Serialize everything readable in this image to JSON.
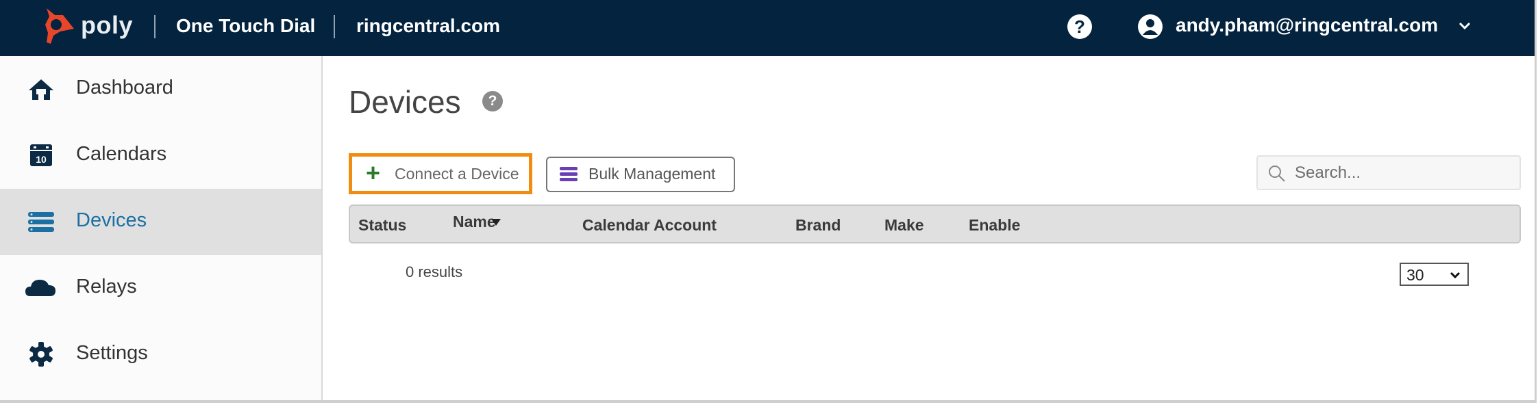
{
  "header": {
    "brand": "poly",
    "app_title": "One Touch Dial",
    "domain": "ringcentral.com",
    "help_glyph": "?",
    "user_email": "andy.pham@ringcentral.com",
    "icons": {
      "logo": "poly-logo-icon",
      "help": "help-circle-icon",
      "user": "user-circle-icon",
      "chevron": "chevron-down-icon"
    },
    "colors": {
      "background": "#03233f",
      "logo": "#e8462a"
    }
  },
  "sidebar": {
    "items": [
      {
        "label": "Dashboard",
        "icon": "home-icon",
        "active": false
      },
      {
        "label": "Calendars",
        "icon": "calendar-icon",
        "icon_text": "10",
        "active": false
      },
      {
        "label": "Devices",
        "icon": "server-list-icon",
        "active": true
      },
      {
        "label": "Relays",
        "icon": "cloud-icon",
        "active": false
      },
      {
        "label": "Settings",
        "icon": "gear-icon",
        "active": false
      }
    ],
    "colors": {
      "active_bg": "#e0e0e0",
      "active_text": "#1b6fa3",
      "icon": "#0d2a44"
    }
  },
  "main": {
    "title": "Devices",
    "help_glyph": "?",
    "toolbar": {
      "connect_label": "Connect a Device",
      "connect_glyph": "+",
      "bulk_label": "Bulk Management",
      "highlight_color": "#f28c11"
    },
    "search": {
      "placeholder": "Search...",
      "value": ""
    },
    "table": {
      "columns": [
        "Status",
        "Name",
        "Calendar Account",
        "Brand",
        "Make",
        "Enable"
      ],
      "sorted_column": "Name",
      "sort_direction": "descending",
      "rows": []
    },
    "results_text": "0 results",
    "page_size": {
      "selected": "30"
    }
  }
}
